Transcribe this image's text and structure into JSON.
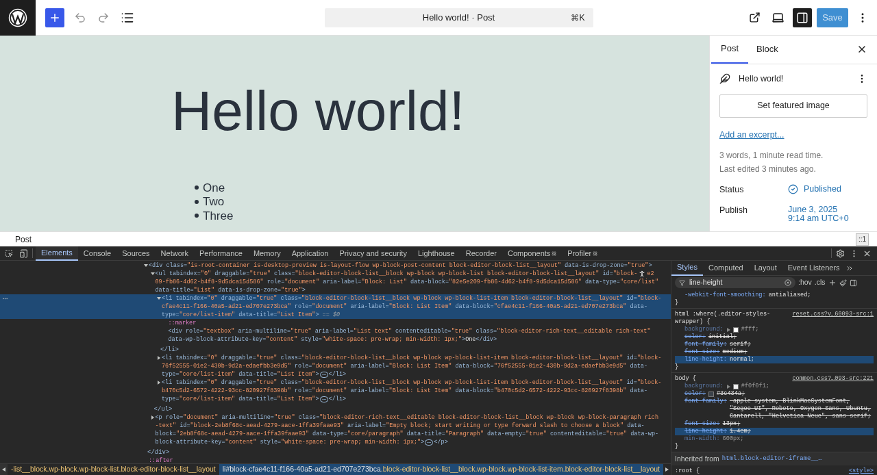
{
  "topbar": {
    "command_title": "Hello world! · Post",
    "shortcut": "⌘K",
    "save": {
      "label": "Save",
      "disabled": true
    },
    "sidebar_toggle": {
      "on": true
    }
  },
  "canvas": {
    "title": "Hello world!",
    "list": [
      "One",
      "Two",
      "Three"
    ]
  },
  "sidebar": {
    "tabs": [
      {
        "label": "Post",
        "selected": true
      },
      {
        "label": "Block",
        "selected": false
      }
    ],
    "post_title": "Hello world!",
    "featured_button": "Set featured image",
    "excerpt_link": "Add an excerpt...",
    "stats": [
      "3 words, 1 minute read time.",
      "Last edited 3 minutes ago."
    ],
    "fields": [
      {
        "label": "Status",
        "kind": "status",
        "value": [
          "Published"
        ]
      },
      {
        "label": "Publish",
        "kind": "date",
        "value": [
          "June 3, 2025",
          "9:14 am UTC+0"
        ]
      }
    ]
  },
  "footer": {
    "breadcrumb": "Post",
    "badge": "::1"
  },
  "devtools": {
    "tabs": [
      {
        "label": "Elements",
        "selected": true,
        "react": false
      },
      {
        "label": "Console",
        "selected": false,
        "react": false
      },
      {
        "label": "Sources",
        "selected": false,
        "react": false
      },
      {
        "label": "Network",
        "selected": false,
        "react": false
      },
      {
        "label": "Performance",
        "selected": false,
        "react": false
      },
      {
        "label": "Memory",
        "selected": false,
        "react": false
      },
      {
        "label": "Application",
        "selected": false,
        "react": false
      },
      {
        "label": "Privacy and security",
        "selected": false,
        "react": false
      },
      {
        "label": "Lighthouse",
        "selected": false,
        "react": false
      },
      {
        "label": "Recorder",
        "selected": false,
        "react": false
      },
      {
        "label": "Components",
        "selected": false,
        "react": true
      },
      {
        "label": "Profiler",
        "selected": false,
        "react": true
      }
    ],
    "tree": [
      {
        "kind": "element",
        "selected": false,
        "expanded": true,
        "lines": [
          "<div class=\"is-root-container is-desktop-preview is-layout-flow wp-block-post-content block-editor-block-list__layout\" data-is-drop-zone=\"true\">"
        ],
        "close": "</div>",
        "children": [
          {
            "kind": "element",
            "selected": false,
            "expanded": true,
            "lines": [
              "<ul tabindex=\"0\" draggable=\"true\" class=\"block-editor-block-list__block wp-block wp-block-list block-editor-block-list__layout\" id=\"block-",
              "09-fb86-4d62-b4f8-9d5dca15d586\" role=\"document\" aria-label=\"Block: List\" data-block=\"82e5e209-fb86-4d62-b4f8-9d5dca15d586\" data-type=\"core/list\"",
              "data-title=\"List\" data-is-drop-zone=\"true\">"
            ],
            "tail": "e2",
            "close": "</ul>",
            "children": [
              {
                "kind": "element",
                "selected": true,
                "expanded": true,
                "suffix": "== $0",
                "lines": [
                  "<li tabindex=\"0\" draggable=\"true\" class=\"block-editor-block-list__block wp-block wp-block-list-item block-editor-block-list__layout\" id=\"block-",
                  "cfae4c11-f166-40a5-ad21-ed707e273bca\" role=\"document\" aria-label=\"Block: List Item\" data-block=\"cfae4c11-f166-40a5-ad21-ed707e273bca\" data-",
                  "type=\"core/list-item\" data-title=\"List Item\">"
                ],
                "close": "</li>",
                "children": [
                  {
                    "kind": "pseudo",
                    "selected": false,
                    "lines": [
                      "::marker"
                    ]
                  },
                  {
                    "kind": "element",
                    "selected": false,
                    "lines": [
                      "<div role=\"textbox\" aria-multiline=\"true\" aria-label=\"List text\" contenteditable=\"true\" class=\"block-editor-rich-text__editable rich-text\"",
                      "data-wp-block-attribute-key=\"content\" style=\"white-space: pre-wrap; min-width: 1px;\">One</div>"
                    ]
                  }
                ]
              },
              {
                "kind": "element",
                "selected": false,
                "expanded": false,
                "lines": [
                  "<li tabindex=\"0\" draggable=\"true\" class=\"block-editor-block-list__block wp-block wp-block-list-item block-editor-block-list__layout\" id=\"block-",
                  "76f52555-01e2-430b-9d2a-edaefbb3e9d5\" role=\"document\" aria-label=\"Block: List Item\" data-block=\"76f52555-01e2-430b-9d2a-edaefbb3e9d5\" data-",
                  "type=\"core/list-item\" data-title=\"List Item\">"
                ],
                "close": "</li>"
              },
              {
                "kind": "element",
                "selected": false,
                "expanded": false,
                "lines": [
                  "<li tabindex=\"0\" draggable=\"true\" class=\"block-editor-block-list__block wp-block wp-block-list-item block-editor-block-list__layout\" id=\"block-",
                  "b470c5d2-6572-4222-93cc-820927f8398b\" role=\"document\" aria-label=\"Block: List Item\" data-block=\"b470c5d2-6572-4222-93cc-820927f8398b\" data-",
                  "type=\"core/list-item\" data-title=\"List Item\">"
                ],
                "close": "</li>"
              }
            ]
          },
          {
            "kind": "element",
            "selected": false,
            "expanded": false,
            "lines": [
              "<p role=\"document\" aria-multiline=\"true\" class=\"block-editor-rich-text__editable block-editor-block-list__block wp-block wp-block-paragraph rich",
              "-text\" id=\"block-2eb8f68c-aead-4279-aace-1ffa39faae93\" aria-label=\"Empty block; start writing or type forward slash to choose a block\" data-",
              "block=\"2eb8f68c-aead-4279-aace-1ffa39faae93\" data-type=\"core/paragraph\" data-title=\"Paragraph\" data-empty=\"true\" contenteditable=\"true\" data-wp-",
              "block-attribute-key=\"content\" style=\"white-space: pre-wrap; min-width: 1px;\">"
            ],
            "close": "</p>"
          }
        ]
      },
      {
        "kind": "pseudo",
        "selected": false,
        "lines": [
          "::after"
        ]
      }
    ],
    "breadcrumbs": [
      {
        "selected": false,
        "classes": "-list__block.wp-block.wp-block-list.block-editor-block-list__layout"
      },
      {
        "selected": true,
        "tag": "li",
        "id": "#block-cfae4c11-f166-40a5-ad21-ed707e273bca",
        "classes": ".block-editor-block-list__block.wp-block.wp-block-list-item.block-editor-block-list__layout"
      }
    ],
    "styles": {
      "tabs": [
        {
          "label": "Styles",
          "selected": true
        },
        {
          "label": "Computed",
          "selected": false
        },
        {
          "label": "Layout",
          "selected": false
        },
        {
          "label": "Event Listeners",
          "selected": false
        }
      ],
      "filter": "line-height",
      "hov": ":hov",
      "cls": ".cls",
      "rules": [
        {
          "decls": [
            {
              "name": "-webkit-font-smoothing:",
              "value": "antialiased;",
              "struck": false,
              "dimmed": false,
              "highlighted": false
            }
          ],
          "close": "}"
        },
        {
          "selector": "html :where(.editor-styles-wrapper) {",
          "source": "reset.css?v…60093-src:1",
          "decls": [
            {
              "name": "background:",
              "value": "#fff;",
              "struck": false,
              "dimmed": true,
              "highlighted": false,
              "expandable": true,
              "color": "#ffffff"
            },
            {
              "name": "color:",
              "value": "initial;",
              "struck": true,
              "dimmed": false,
              "highlighted": false
            },
            {
              "name": "font-family:",
              "value": "serif;",
              "struck": true,
              "dimmed": false,
              "highlighted": false
            },
            {
              "name": "font-size:",
              "value": "medium;",
              "struck": true,
              "dimmed": false,
              "highlighted": false
            },
            {
              "name": "line-height:",
              "value": "normal;",
              "struck": false,
              "dimmed": false,
              "highlighted": true
            }
          ],
          "close": "}"
        },
        {
          "selector": "body {",
          "source": "common.css?…093-src:221",
          "decls": [
            {
              "name": "background:",
              "value": "#f0f0f1;",
              "struck": false,
              "dimmed": true,
              "highlighted": false,
              "expandable": true,
              "color": "#f0f0f1"
            },
            {
              "name": "color:",
              "value": "#3c434a;",
              "struck": true,
              "dimmed": false,
              "highlighted": false,
              "color": "#3c434a"
            },
            {
              "name": "font-family:",
              "value": "-apple-system, BlinkMacSystemFont, \"Segoe UI\", Roboto, Oxygen-Sans, Ubuntu, Cantarell, \"Helvetica Neue\", sans-serif;",
              "struck": true,
              "dimmed": false,
              "highlighted": false
            },
            {
              "name": "font-size:",
              "value": "13px;",
              "struck": true,
              "dimmed": false,
              "highlighted": false
            },
            {
              "name": "line-height:",
              "value": "1.4em;",
              "struck": true,
              "dimmed": false,
              "highlighted": true
            },
            {
              "name": "min-width:",
              "value": "600px;",
              "struck": false,
              "dimmed": true,
              "highlighted": false
            }
          ],
          "close": "}"
        }
      ],
      "inherited_label": "Inherited from",
      "inherited_from": "html.block-editor-iframe__…",
      "next_rule": ":root {",
      "next_source": "<style>"
    }
  }
}
